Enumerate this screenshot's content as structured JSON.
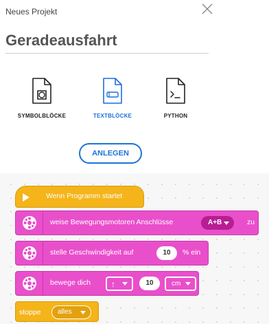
{
  "dialog": {
    "title": "Neues Projekt",
    "project_name": "Geradeausfahrt",
    "options": [
      {
        "label": "SYMBOLBLÖCKE",
        "icon": "word-blocks-file-icon",
        "selected": false
      },
      {
        "label": "TEXTBLÖCKE",
        "icon": "icon-blocks-file-icon",
        "selected": true
      },
      {
        "label": "PYTHON",
        "icon": "python-terminal-file-icon",
        "selected": false
      }
    ],
    "create_label": "ANLEGEN"
  },
  "program": {
    "start_block": {
      "label": "Wenn Programm startet"
    },
    "block_motors": {
      "text_before": "weise Bewegungsmotoren Anschlüsse",
      "ports": "A+B",
      "text_after": "zu"
    },
    "block_speed": {
      "text_before": "stelle Geschwindigkeit auf",
      "value": "10",
      "text_after": "% ein"
    },
    "block_move": {
      "text_before": "bewege dich",
      "direction": "↑",
      "value": "10",
      "unit": "cm"
    },
    "stop_block": {
      "label": "stoppe",
      "option": "alles"
    }
  },
  "colors": {
    "accent_blue": "#1c74d4",
    "events_yellow": "#f4b41a",
    "motor_magenta": "#e94fcb",
    "port_pill": "#b81e93"
  }
}
